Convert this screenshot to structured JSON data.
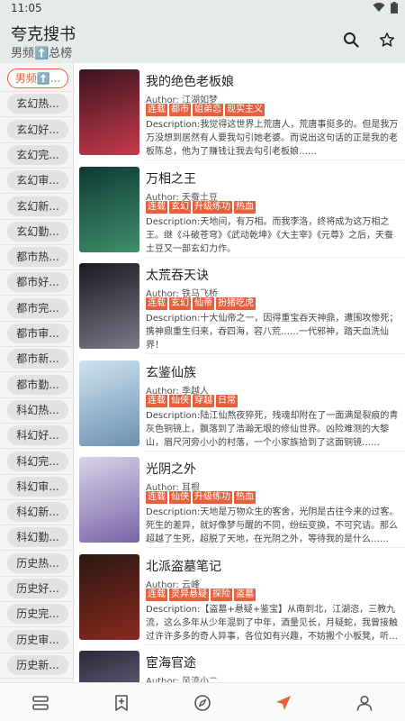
{
  "status": {
    "time": "11:05"
  },
  "header": {
    "title": "夸克搜书",
    "subtitle": "男频⬆️总榜"
  },
  "categories": [
    "男频⬆️...",
    "玄幻热...",
    "玄幻好...",
    "玄幻完...",
    "玄幻审...",
    "玄幻新...",
    "玄幻勤...",
    "都市热...",
    "都市好...",
    "都市完...",
    "都市审...",
    "都市新...",
    "都市勤...",
    "科幻热...",
    "科幻好...",
    "科幻完...",
    "科幻审...",
    "科幻新...",
    "科幻勤...",
    "历史热...",
    "历史好...",
    "历史完...",
    "历史审...",
    "历史新..."
  ],
  "author_prefix": "Author: ",
  "desc_prefix": "Description:",
  "books": [
    {
      "title": "我的绝色老板娘",
      "author": "江湖如梦",
      "tags": [
        "连载",
        "都市",
        "姐弟恋",
        "现实主义"
      ],
      "desc": "我觉得这世界上荒唐人，荒唐事挺多的。但是我万万没想到居然有人要我勾引她老婆。而说出这句话的正是我的老板陈总，他为了赚钱让我去勾引老板娘……"
    },
    {
      "title": "万相之王",
      "author": "天蚕土豆",
      "tags": [
        "连载",
        "玄幻",
        "升级练功",
        "热血"
      ],
      "desc": "天地间，有万相。而我李洛，终将成为这万相之王。继《斗破苍穹》《武动乾坤》《大主宰》《元尊》之后，天蚕土豆又一部玄幻力作。"
    },
    {
      "title": "太荒吞天诀",
      "author": "铁马飞桥",
      "tags": [
        "连载",
        "玄幻",
        "仙帝",
        "扮猪吃虎"
      ],
      "desc": "十大仙帝之一，因得重宝吞天神鼎，遭围攻惨死；携神鼎重生归来，吞四海，容八荒……一代邪神，踏天血洗仙界！"
    },
    {
      "title": "玄鉴仙族",
      "author": "季越人",
      "tags": [
        "连载",
        "仙侠",
        "穿越",
        "日常"
      ],
      "desc": "陆江仙熬夜猝死，残魂却附在了一面满是裂痕的青灰色铜镜上，飘落到了浩瀚无垠的修仙世界。凶险难测的大黎山，眉尺河旁小小的村落，一个小家族拾到了这面铜镜……"
    },
    {
      "title": "光阴之外",
      "author": "耳根",
      "tags": [
        "连载",
        "仙侠",
        "升级练功",
        "热血"
      ],
      "desc": "天地是万物众生的客舍，光阴是古往今来的过客。死生的差异，就好像梦与醒的不同，纷纭变换，不可究诘。那么超越了生死，超脱了天地，在光阴之外，等待我的是什么……"
    },
    {
      "title": "北派盗墓笔记",
      "author": "云峰",
      "tags": [
        "连载",
        "灵异悬疑",
        "探险",
        "盗墓"
      ],
      "desc": "【盗墓+悬疑+鉴宝】从南到北，江湖恣，三教九流，这么多年从少年混到了中年，酒量见长，月疑蛇，我曾接触过许许多多的奇人异事，各位如有兴趣，不妨搬个小板凳，听我云峰讲一讲……"
    },
    {
      "title": "宦海官途",
      "author": "风流小二",
      "tags": [],
      "desc": ""
    }
  ]
}
